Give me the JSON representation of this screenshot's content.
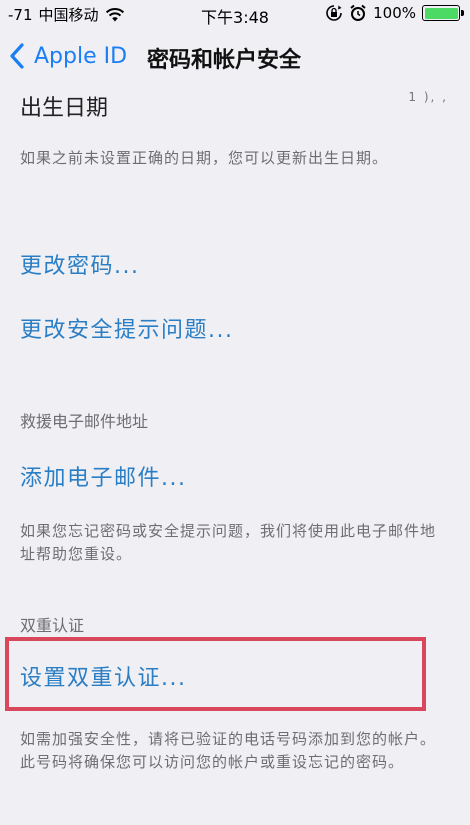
{
  "status": {
    "signal": "-71",
    "carrier": "中国移动",
    "time": "下午3:48",
    "battery": "100%",
    "battery_level": 1.0,
    "battery_color": "#4cd964"
  },
  "nav": {
    "back_label": "Apple ID",
    "title": "密码和帐户安全"
  },
  "birthday": {
    "label": "出生日期",
    "value_cut": "1 ),  ,  ",
    "desc": "如果之前未设置正确的日期，您可以更新出生日期。"
  },
  "actions": {
    "change_password": "更改密码...",
    "change_questions": "更改安全提示问题..."
  },
  "rescue_email": {
    "header": "救援电子邮件地址",
    "add": "添加电子邮件...",
    "desc": "如果您忘记密码或安全提示问题，我们将使用此电子邮件地址帮助您重设。"
  },
  "two_factor": {
    "header": "双重认证",
    "setup": "设置双重认证...",
    "desc": "如需加强安全性，请将已验证的电话号码添加到您的帐户。此号码将确保您可以访问您的帐户或重设忘记的密码。"
  },
  "colors": {
    "accent": "#2a7ec5",
    "highlight": "#d9475c",
    "background": "#efeff4"
  }
}
